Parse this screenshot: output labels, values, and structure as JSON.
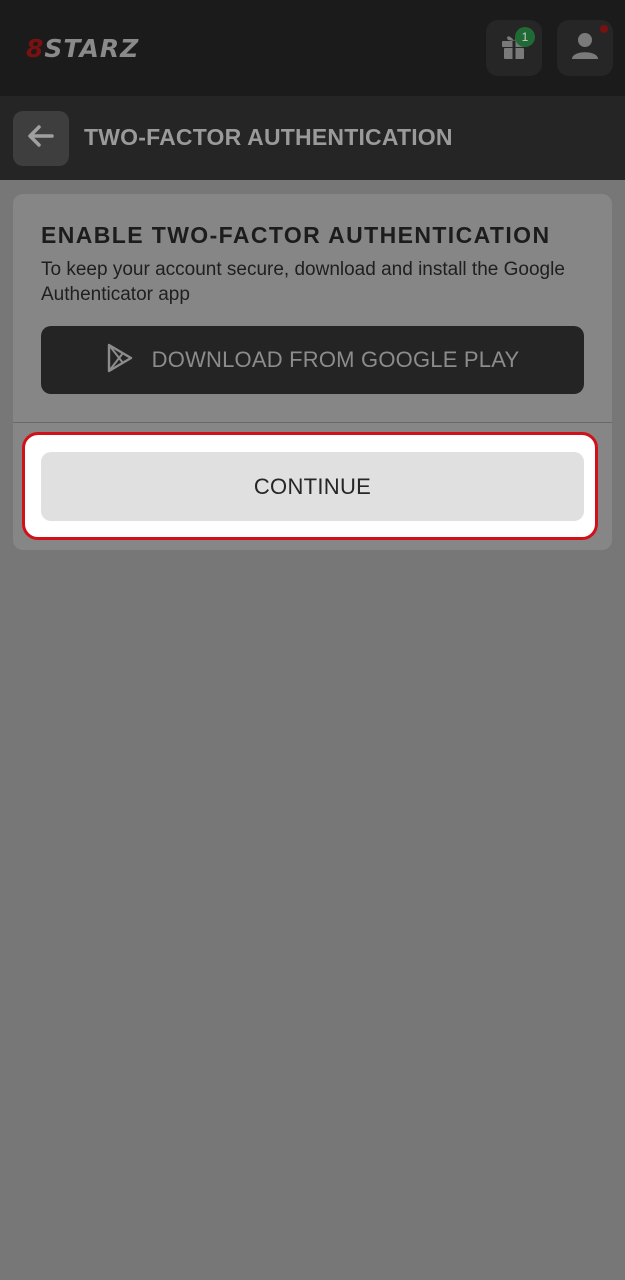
{
  "header": {
    "logo_prefix": "8",
    "logo_word": "STARZ",
    "gift_badge_count": "1"
  },
  "titlebar": {
    "title": "TWO-FACTOR AUTHENTICATION"
  },
  "card": {
    "heading": "ENABLE TWO-FACTOR AUTHENTICATION",
    "description": "To keep your account secure, download and install the Google Authenticator app",
    "download_label": "DOWNLOAD FROM GOOGLE PLAY",
    "continue_label": "CONTINUE"
  },
  "icons": {
    "gift": "gift-icon",
    "profile": "user-icon",
    "back": "arrow-left-icon",
    "play": "google-play-icon"
  },
  "colors": {
    "highlight_border": "#d1111a",
    "badge_green": "#1f6a35",
    "brand_red": "#7a1111"
  }
}
